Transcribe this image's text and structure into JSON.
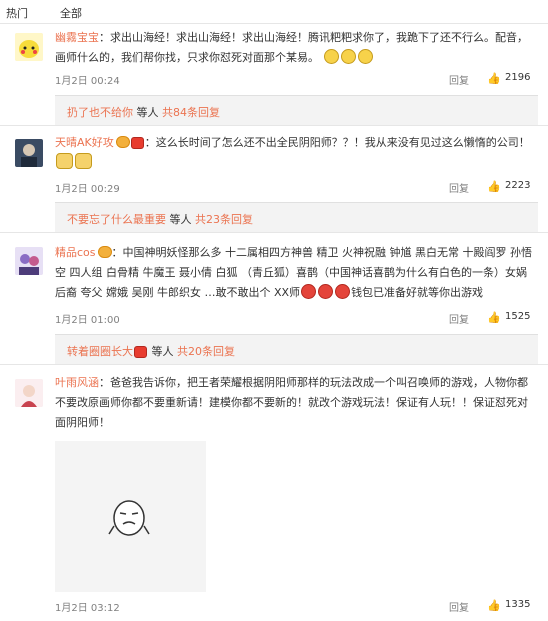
{
  "tabs": [
    "热门",
    "全部"
  ],
  "comments": [
    {
      "username": "幽霧宝宝",
      "text": "：求出山海经！求出山海经！求出山海经！腾讯粑粑求你了，我跪下了还不行么。配音，画师什么的，我们帮你找，只求你怼死对面那个某易。",
      "date": "1月2日 00:24",
      "reply": "回复",
      "likes": "2196",
      "sub": {
        "user": "扔了也不给你",
        "mid": " 等人 ",
        "count": "共84条回复"
      }
    },
    {
      "username": "天晴AK好攻",
      "text": "：这么长时间了怎么还不出全民阴阳师？？！我从来没有见过这么懒惰的公司！",
      "date": "1月2日 00:29",
      "reply": "回复",
      "likes": "2223",
      "sub": {
        "user": "不要忘了什么最重要",
        "mid": " 等人 ",
        "count": "共23条回复"
      }
    },
    {
      "username": "精品cos",
      "text_a": "：中国神明妖怪那么多 十二属相四方神兽 精卫 火神祝融 钟馗 黑白无常 十殿阎罗 孙悟空 四人组 白骨精 牛魔王 聂小倩 白狐 （青丘狐）喜鹊（中国神话喜鹊为什么有白色的一条）女娲后裔 夸父 嫦娥 吴刚 牛郎织女 …敢不敢出个 XX师",
      "text_b": "钱包已准备好就等你出游戏",
      "date": "1月2日 01:00",
      "reply": "回复",
      "likes": "1525",
      "sub": {
        "user": "转着圈圈长大",
        "mid": " 等人 ",
        "count": "共20条回复"
      }
    },
    {
      "username": "叶雨风涵",
      "text": "：爸爸我告诉你，把王者荣耀根据阴阳师那样的玩法改成一个叫召唤师的游戏，人物你都不要改原画师你都不要重新请！建模你都不要新的！就改个游戏玩法！保证有人玩！！保证怼死对面阴阳师！",
      "date": "1月2日 03:12",
      "reply": "回复",
      "likes": "1335"
    }
  ],
  "colors": {
    "accent": "#eb7350",
    "subbox": "#f3f3f3"
  },
  "icons": [
    "thumbs-up-icon",
    "emoji-icon",
    "cat-emoji-icon",
    "vip-crown-icon"
  ]
}
